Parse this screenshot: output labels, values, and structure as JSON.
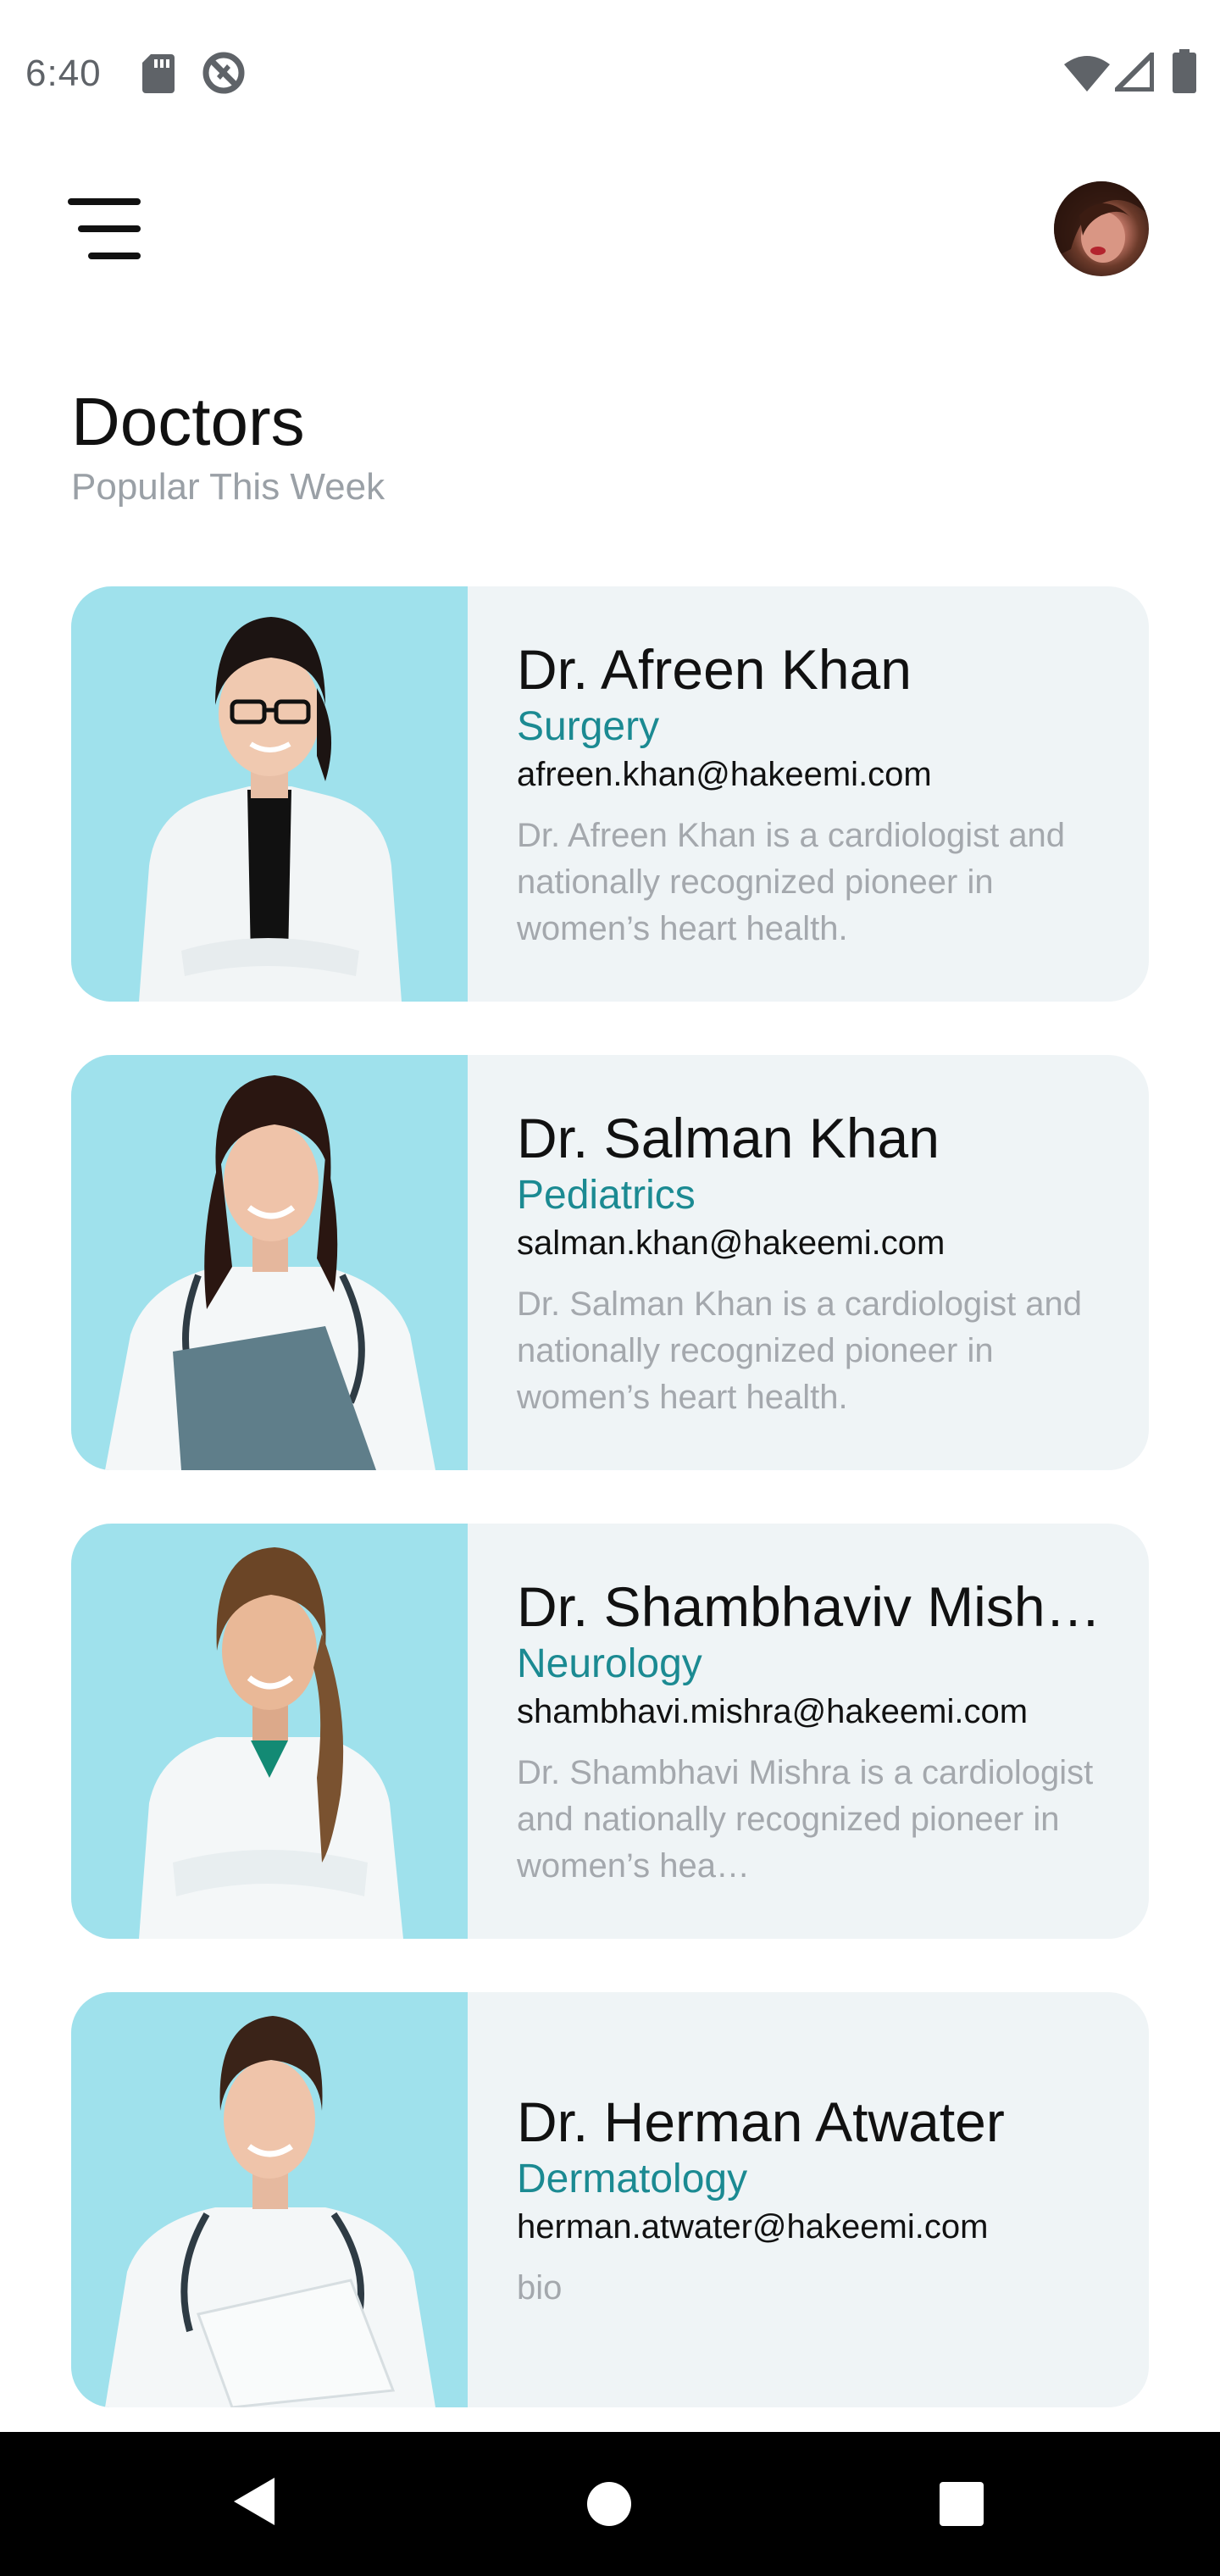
{
  "status_bar": {
    "time": "6:40",
    "icons": [
      "sd-card-icon",
      "blocked-icon",
      "wifi-icon",
      "signal-icon",
      "battery-icon"
    ]
  },
  "top_bar": {
    "menu_icon": "hamburger-menu-icon",
    "avatar_icon": "user-avatar"
  },
  "header": {
    "title": "Doctors",
    "subtitle": "Popular This Week"
  },
  "doctors": [
    {
      "name": "Dr. Afreen Khan",
      "specialty": "Surgery",
      "email": "afreen.khan@hakeemi.com",
      "bio": "Dr. Afreen Khan is a cardiologist and nationally recognized pioneer in women’s heart health."
    },
    {
      "name": "Dr. Salman Khan",
      "specialty": "Pediatrics",
      "email": "salman.khan@hakeemi.com",
      "bio": "Dr. Salman Khan is a cardiologist and nationally recognized pioneer in women’s heart health."
    },
    {
      "name": "Dr. Shambhaviv Mish…",
      "specialty": "Neurology",
      "email": "shambhavi.mishra@hakeemi.com",
      "bio": "Dr. Shambhavi Mishra is a cardiologist and nationally recognized pioneer in women’s hea…"
    },
    {
      "name": "Dr. Herman Atwater",
      "specialty": "Dermatology",
      "email": "herman.atwater@hakeemi.com",
      "bio": "bio"
    }
  ],
  "nav_bar": {
    "icons": [
      "back-icon",
      "home-icon",
      "recents-icon"
    ]
  },
  "colors": {
    "accent": "#1b8a92",
    "card_background": "#eff4f6",
    "photo_background": "#9fe1ec",
    "muted_text": "#a4a8ad"
  }
}
